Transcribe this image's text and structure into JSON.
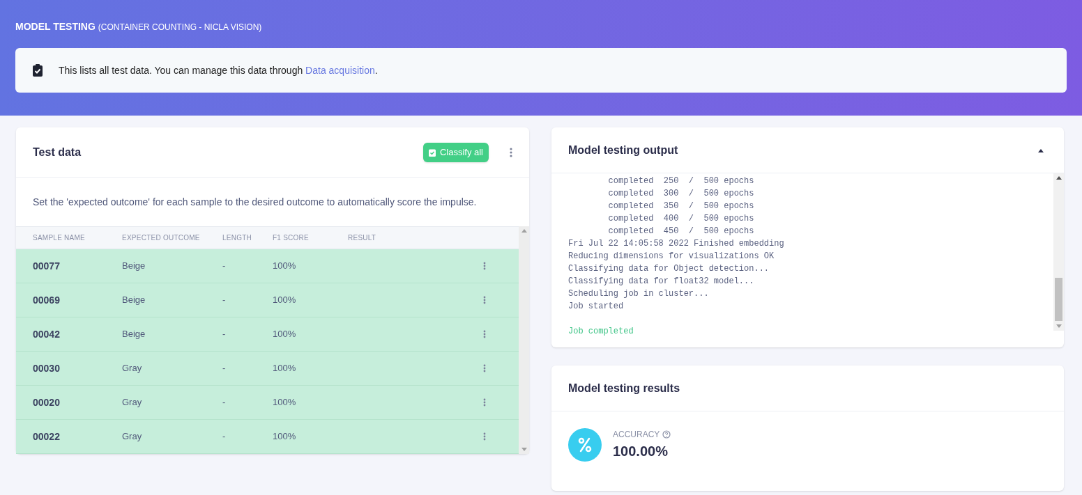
{
  "header": {
    "title": "MODEL TESTING",
    "subtitle": "(CONTAINER COUNTING - NICLA VISION)"
  },
  "notice": {
    "text": "This lists all test data. You can manage this data through ",
    "link": "Data acquisition",
    "suffix": "."
  },
  "test_data": {
    "title": "Test data",
    "classify_button": "Classify all",
    "description": "Set the 'expected outcome' for each sample to the desired outcome to automatically score the impulse.",
    "columns": [
      "SAMPLE NAME",
      "EXPECTED OUTCOME",
      "LENGTH",
      "F1 SCORE",
      "RESULT"
    ],
    "rows": [
      {
        "sample": "00077",
        "expected": "Beige",
        "length": "-",
        "f1": "100%",
        "correct": true
      },
      {
        "sample": "00069",
        "expected": "Beige",
        "length": "-",
        "f1": "100%",
        "correct": true
      },
      {
        "sample": "00042",
        "expected": "Beige",
        "length": "-",
        "f1": "100%",
        "correct": true
      },
      {
        "sample": "00030",
        "expected": "Gray",
        "length": "-",
        "f1": "100%",
        "correct": true
      },
      {
        "sample": "00020",
        "expected": "Gray",
        "length": "-",
        "f1": "100%",
        "correct": true
      },
      {
        "sample": "00022",
        "expected": "Gray",
        "length": "-",
        "f1": "100%",
        "correct": true
      }
    ]
  },
  "output": {
    "title": "Model testing output",
    "expanded": true,
    "lines": [
      {
        "kind": "info",
        "text": "        completed  250  /  500 epochs"
      },
      {
        "kind": "info",
        "text": "        completed  300  /  500 epochs"
      },
      {
        "kind": "info",
        "text": "        completed  350  /  500 epochs"
      },
      {
        "kind": "info",
        "text": "        completed  400  /  500 epochs"
      },
      {
        "kind": "info",
        "text": "        completed  450  /  500 epochs"
      },
      {
        "kind": "info",
        "text": "Fri Jul 22 14:05:58 2022 Finished embedding"
      },
      {
        "kind": "info",
        "text": "Reducing dimensions for visualizations OK"
      },
      {
        "kind": "info",
        "text": "Classifying data for Object detection..."
      },
      {
        "kind": "info",
        "text": "Classifying data for float32 model..."
      },
      {
        "kind": "info",
        "text": "Scheduling job in cluster..."
      },
      {
        "kind": "info",
        "text": "Job started"
      },
      {
        "kind": "success",
        "text": "Job completed"
      }
    ]
  },
  "results": {
    "title": "Model testing results",
    "metric_label": "ACCURACY",
    "metric_value": "100.00%"
  }
}
